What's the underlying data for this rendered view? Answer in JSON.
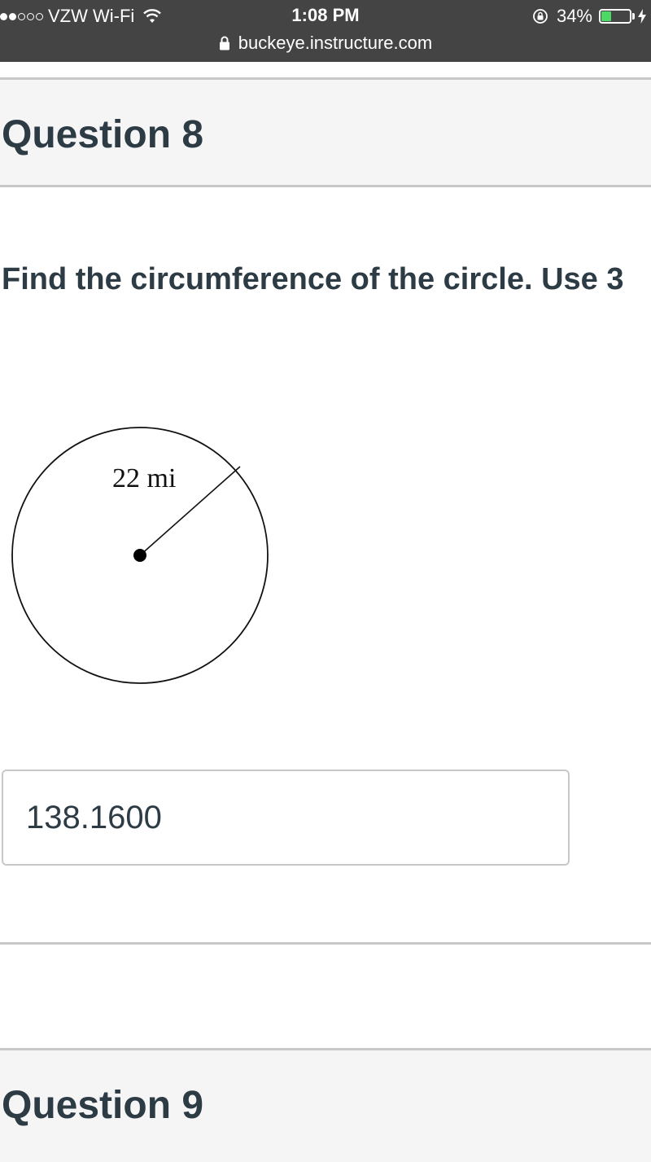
{
  "status_bar": {
    "carrier": "VZW Wi-Fi",
    "time": "1:08 PM",
    "battery_percent": "34%",
    "battery_level": 0.34,
    "signal_bars_filled": 2,
    "signal_bars_total": 5,
    "url": "buckeye.instructure.com",
    "icons": [
      "wifi-icon",
      "rotation-lock-icon",
      "battery-icon",
      "charging-bolt-icon",
      "lock-icon"
    ]
  },
  "question8": {
    "title": "Question 8",
    "prompt": "Find the circumference of the circle. Use 3",
    "figure": {
      "label": "22 mi"
    },
    "answer_value": "138.1600"
  },
  "question9": {
    "title": "Question 9"
  },
  "colors": {
    "status_bar_bg": "#444444",
    "battery_green": "#4cd964",
    "heading_text": "#2d3b45",
    "header_bg": "#f5f5f5",
    "border": "#c8c8c8"
  }
}
